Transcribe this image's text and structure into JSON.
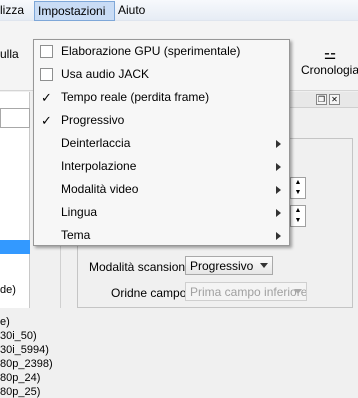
{
  "menubar": {
    "edit_partial": "lizza",
    "settings": "Impostazioni",
    "help": "Aiuto"
  },
  "toolbar": {
    "left_partial": "ulla",
    "right_partial": "t",
    "timeline": "Cronologia"
  },
  "left_list": [
    "de)",
    "e)",
    "30i_50)",
    "30i_5994)",
    "80p_2398)",
    "80p_24)",
    "80p_25)"
  ],
  "properties": {
    "scan_mode_label": "Modalità scansione",
    "scan_mode_value": "Progressivo",
    "field_order_label": "Oridne campo",
    "field_order_value": "Prima campo inferiore"
  },
  "settings_menu": {
    "items": [
      {
        "label": "Elaborazione GPU (sperimentale)",
        "checkable": true,
        "checked": false,
        "submenu": false
      },
      {
        "label": "Usa audio JACK",
        "checkable": true,
        "checked": false,
        "submenu": false
      },
      {
        "label": "Tempo reale (perdita frame)",
        "checkable": true,
        "checked": true,
        "submenu": false
      },
      {
        "label": "Progressivo",
        "checkable": true,
        "checked": true,
        "submenu": false
      },
      {
        "label": "Deinterlaccia",
        "checkable": false,
        "checked": false,
        "submenu": true
      },
      {
        "label": "Interpolazione",
        "checkable": false,
        "checked": false,
        "submenu": true
      },
      {
        "label": "Modalità video",
        "checkable": false,
        "checked": false,
        "submenu": true
      },
      {
        "label": "Lingua",
        "checkable": false,
        "checked": false,
        "submenu": true
      },
      {
        "label": "Tema",
        "checkable": false,
        "checked": false,
        "submenu": true
      }
    ],
    "check_glyph": "✓"
  }
}
